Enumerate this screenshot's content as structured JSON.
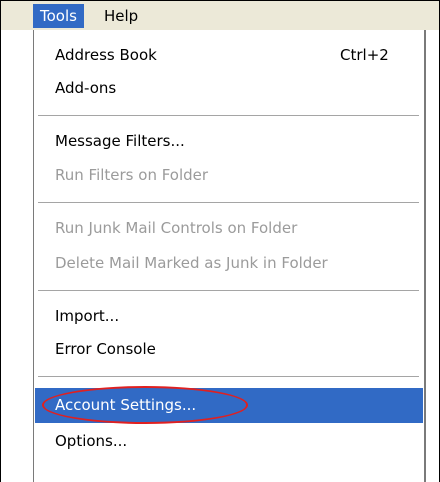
{
  "menubar": {
    "tools_label": "Tools",
    "help_label": "Help"
  },
  "tools_menu": {
    "address_book": {
      "label": "Address Book",
      "shortcut": "Ctrl+2"
    },
    "add_ons": {
      "label": "Add-ons"
    },
    "message_filters": {
      "label": "Message Filters..."
    },
    "run_filters": {
      "label": "Run Filters on Folder",
      "enabled": false
    },
    "run_junk": {
      "label": "Run Junk Mail Controls on Folder",
      "enabled": false
    },
    "delete_junk": {
      "label": "Delete Mail Marked as Junk in Folder",
      "enabled": false
    },
    "import": {
      "label": "Import..."
    },
    "error_console": {
      "label": "Error Console"
    },
    "account_settings": {
      "label": "Account Settings...",
      "highlighted": true
    },
    "options": {
      "label": "Options..."
    }
  },
  "colors": {
    "selection": "#316ac5",
    "annotation_circle": "#e02020",
    "menubar_bg": "#ece9d8"
  }
}
